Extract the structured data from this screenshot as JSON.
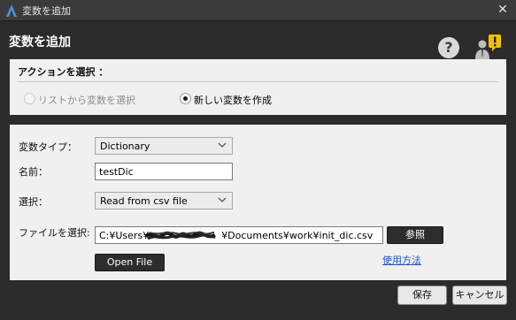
{
  "window": {
    "title": "変数を追加",
    "close_glyph": "✕"
  },
  "header": {
    "title": "変数を追加",
    "help_glyph": "?"
  },
  "action_panel": {
    "label": "アクションを選択 ：",
    "option_list": "リストから変数を選択",
    "option_new": "新しい変数を作成",
    "selected": "option_new"
  },
  "form": {
    "type_label": "変数タイプ：",
    "type_value": "Dictionary",
    "name_label": "名前：",
    "name_value": "testDic",
    "select_label": "選択：",
    "select_value": "Read from csv file",
    "file_label": "ファイルを選択:",
    "file_path_start": "C:¥Users¥",
    "file_path_end": "¥Documents¥work¥init_dic.csv",
    "browse_label": "参照",
    "open_file_label": "Open File",
    "usage_link": "使用方法"
  },
  "footer": {
    "save_label": "保存",
    "cancel_label": "キャンセル"
  },
  "colors": {
    "chrome": "#2b2b2b",
    "panel": "#f0f0f0",
    "link": "#1f52d9",
    "warn": "#f2c200",
    "logo": "#4a90e2"
  },
  "icons": [
    "app-logo-icon",
    "close-icon",
    "help-icon",
    "user-warning-icon",
    "chevron-down-icon",
    "radio-icon"
  ]
}
